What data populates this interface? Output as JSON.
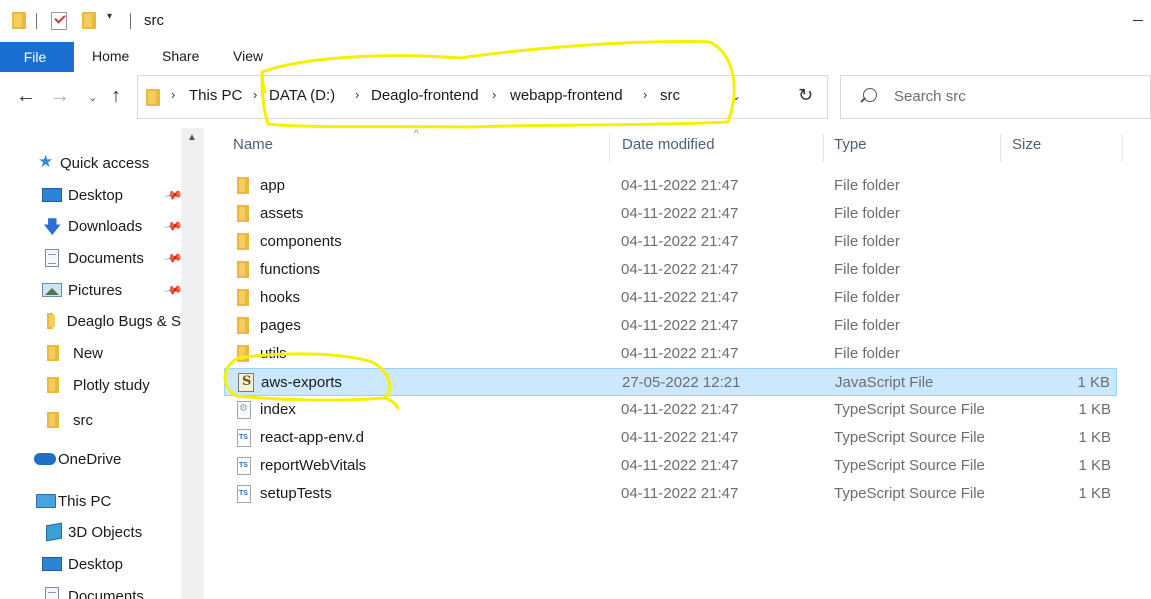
{
  "window": {
    "title": "src"
  },
  "ribbon": {
    "tabs": [
      {
        "label": "File",
        "active": true
      },
      {
        "label": "Home"
      },
      {
        "label": "Share"
      },
      {
        "label": "View"
      }
    ]
  },
  "address": {
    "crumbs": [
      "This PC",
      "DATA (D:)",
      "Deaglo-frontend",
      "webapp-frontend",
      "src"
    ]
  },
  "search": {
    "placeholder": "Search src"
  },
  "sidebar": {
    "items": [
      {
        "label": "Quick access",
        "icon": "star-icon",
        "pinned": false
      },
      {
        "label": "Desktop",
        "icon": "desktop-icon",
        "pinned": true
      },
      {
        "label": "Downloads",
        "icon": "downloads-icon",
        "pinned": true
      },
      {
        "label": "Documents",
        "icon": "documents-icon",
        "pinned": true
      },
      {
        "label": "Pictures",
        "icon": "pictures-icon",
        "pinned": true
      },
      {
        "label": "Deaglo Bugs & S",
        "icon": "folder-icon",
        "pinned": false
      },
      {
        "label": "New",
        "icon": "folder-icon",
        "pinned": false
      },
      {
        "label": "Plotly study",
        "icon": "folder-icon",
        "pinned": false
      },
      {
        "label": "src",
        "icon": "folder-icon",
        "pinned": false
      },
      {
        "label": "OneDrive",
        "icon": "cloud-icon",
        "pinned": false
      },
      {
        "label": "This PC",
        "icon": "pc-icon",
        "pinned": false
      },
      {
        "label": "3D Objects",
        "icon": "cube-icon",
        "pinned": false
      },
      {
        "label": "Desktop",
        "icon": "desktop-icon",
        "pinned": false
      },
      {
        "label": "Documents",
        "icon": "documents-icon",
        "pinned": false
      }
    ]
  },
  "columns": {
    "name": "Name",
    "date": "Date modified",
    "type": "Type",
    "size": "Size"
  },
  "files": [
    {
      "name": "app",
      "date": "04-11-2022 21:47",
      "type": "File folder",
      "size": "",
      "icon": "folder-icon"
    },
    {
      "name": "assets",
      "date": "04-11-2022 21:47",
      "type": "File folder",
      "size": "",
      "icon": "folder-icon"
    },
    {
      "name": "components",
      "date": "04-11-2022 21:47",
      "type": "File folder",
      "size": "",
      "icon": "folder-icon"
    },
    {
      "name": "functions",
      "date": "04-11-2022 21:47",
      "type": "File folder",
      "size": "",
      "icon": "folder-icon"
    },
    {
      "name": "hooks",
      "date": "04-11-2022 21:47",
      "type": "File folder",
      "size": "",
      "icon": "folder-icon"
    },
    {
      "name": "pages",
      "date": "04-11-2022 21:47",
      "type": "File folder",
      "size": "",
      "icon": "folder-icon"
    },
    {
      "name": "utils",
      "date": "04-11-2022 21:47",
      "type": "File folder",
      "size": "",
      "icon": "folder-icon"
    },
    {
      "name": "aws-exports",
      "date": "27-05-2022 12:21",
      "type": "JavaScript File",
      "size": "1 KB",
      "icon": "javascript-file-icon",
      "selected": true
    },
    {
      "name": "index",
      "date": "04-11-2022 21:47",
      "type": "TypeScript Source File",
      "size": "1 KB",
      "icon": "settings-file-icon"
    },
    {
      "name": "react-app-env.d",
      "date": "04-11-2022 21:47",
      "type": "TypeScript Source File",
      "size": "1 KB",
      "icon": "typescript-file-icon"
    },
    {
      "name": "reportWebVitals",
      "date": "04-11-2022 21:47",
      "type": "TypeScript Source File",
      "size": "1 KB",
      "icon": "typescript-file-icon"
    },
    {
      "name": "setupTests",
      "date": "04-11-2022 21:47",
      "type": "TypeScript Source File",
      "size": "1 KB",
      "icon": "typescript-file-icon"
    }
  ],
  "colors": {
    "accent": "#1a6fd1",
    "selection": "#cce8ff",
    "annotation": "#f5f000"
  }
}
